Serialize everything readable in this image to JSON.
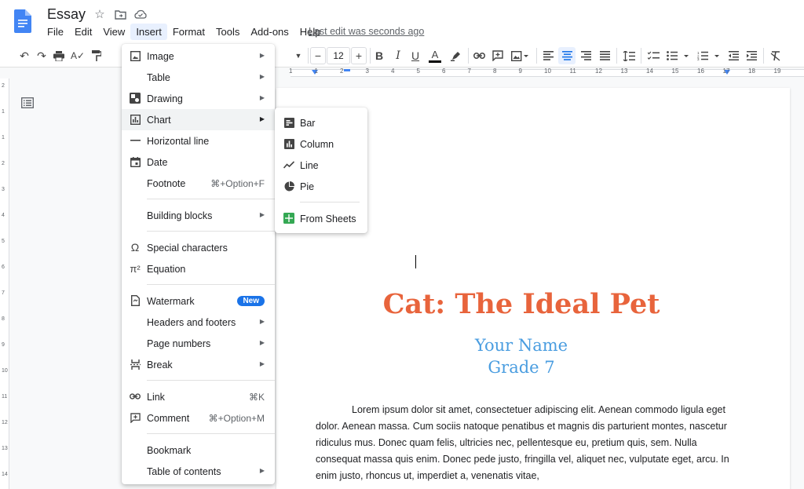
{
  "header": {
    "doc_title": "Essay",
    "last_edit": "Last edit was seconds ago",
    "menus": [
      "File",
      "Edit",
      "View",
      "Insert",
      "Format",
      "Tools",
      "Add-ons",
      "Help"
    ],
    "active_menu": "Insert"
  },
  "toolbar": {
    "font_size": "12",
    "minus": "−",
    "plus": "+"
  },
  "ruler": {
    "numbers": [
      "1",
      "1",
      "2",
      "3",
      "4",
      "5",
      "6",
      "7",
      "8",
      "9",
      "10",
      "11",
      "12",
      "13",
      "14",
      "15",
      "16",
      "17",
      "18",
      "19"
    ],
    "vertical_numbers": [
      "2",
      "1",
      "1",
      "2",
      "3",
      "4",
      "5",
      "6",
      "7",
      "8",
      "9",
      "10",
      "11",
      "12",
      "13",
      "14"
    ]
  },
  "insert_menu": {
    "items": [
      {
        "label": "Image",
        "icon": "image-icon",
        "arrow": true
      },
      {
        "label": "Table",
        "icon": "",
        "arrow": true
      },
      {
        "label": "Drawing",
        "icon": "drawing-icon",
        "arrow": true
      },
      {
        "label": "Chart",
        "icon": "chart-icon",
        "arrow": true
      },
      {
        "label": "Horizontal line",
        "icon": "horizontal-line-icon"
      },
      {
        "label": "Date",
        "icon": "date-icon"
      },
      {
        "label": "Footnote",
        "icon": "",
        "shortcut": "⌘+Option+F"
      },
      {
        "label": "Building blocks",
        "icon": "",
        "arrow": true
      },
      {
        "label": "Special characters",
        "icon": "omega-icon"
      },
      {
        "label": "Equation",
        "icon": "pi-icon"
      },
      {
        "label": "Watermark",
        "icon": "watermark-icon",
        "badge": "New"
      },
      {
        "label": "Headers and footers",
        "icon": "",
        "arrow": true
      },
      {
        "label": "Page numbers",
        "icon": "",
        "arrow": true
      },
      {
        "label": "Break",
        "icon": "break-icon",
        "arrow": true
      },
      {
        "label": "Link",
        "icon": "link-icon",
        "shortcut": "⌘K"
      },
      {
        "label": "Comment",
        "icon": "comment-icon",
        "shortcut": "⌘+Option+M"
      },
      {
        "label": "Bookmark",
        "icon": ""
      },
      {
        "label": "Table of contents",
        "icon": "",
        "arrow": true
      }
    ]
  },
  "chart_submenu": {
    "items": [
      {
        "label": "Bar",
        "icon": "bar-chart-icon"
      },
      {
        "label": "Column",
        "icon": "column-chart-icon"
      },
      {
        "label": "Line",
        "icon": "line-chart-icon"
      },
      {
        "label": "Pie",
        "icon": "pie-chart-icon"
      },
      {
        "label": "From Sheets",
        "icon": "sheets-icon"
      }
    ]
  },
  "document": {
    "title": "Cat: The Ideal Pet",
    "name": "Your Name",
    "grade": "Grade 7",
    "body": "Lorem ipsum dolor sit amet, consectetuer adipiscing elit. Aenean commodo ligula eget dolor. Aenean massa. Cum sociis natoque penatibus et magnis dis parturient montes, nascetur ridiculus mus. Donec quam felis, ultricies nec, pellentesque eu, pretium quis, sem. Nulla consequat massa quis enim. Donec pede justo, fringilla vel, aliquet nec, vulputate eget, arcu. In enim justo, rhoncus ut, imperdiet a, venenatis vitae,"
  },
  "colors": {
    "title": "#e8643c",
    "subtitle": "#4a9de0",
    "accent": "#1a73e8"
  }
}
